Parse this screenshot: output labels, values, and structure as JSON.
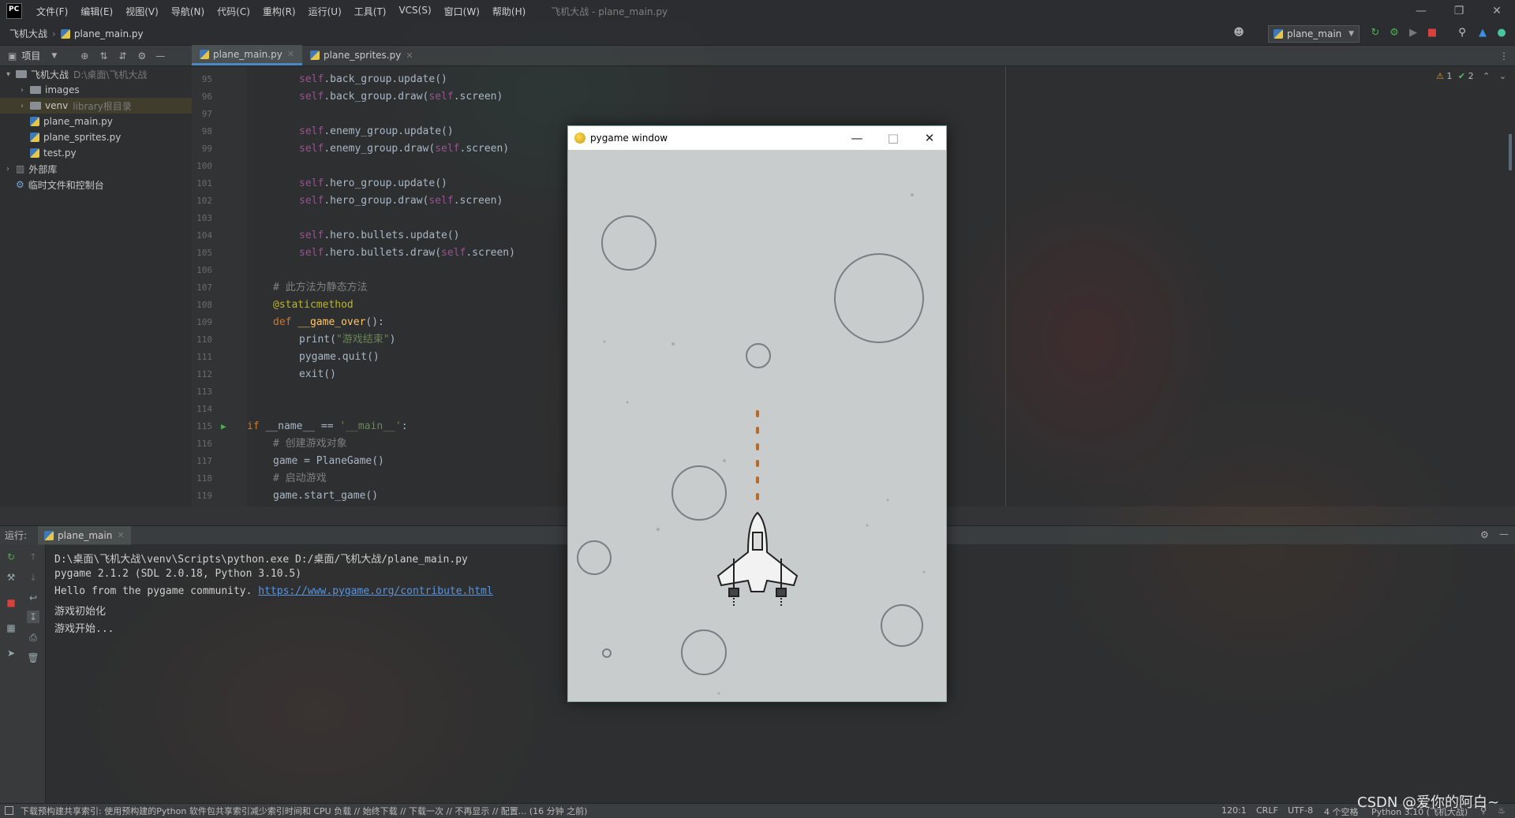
{
  "app": {
    "logo": "PC",
    "window_title": "飞机大战 - plane_main.py",
    "menu": [
      "文件(F)",
      "编辑(E)",
      "视图(V)",
      "导航(N)",
      "代码(C)",
      "重构(R)",
      "运行(U)",
      "工具(T)",
      "VCS(S)",
      "窗口(W)",
      "帮助(H)"
    ]
  },
  "navbar": {
    "project": "飞机大战",
    "file": "plane_main.py",
    "run_config": "plane_main"
  },
  "project_panel": {
    "title": "项目",
    "items": [
      {
        "label": "飞机大战",
        "hint": "D:\\桌面\\飞机大战",
        "type": "folder",
        "depth": 0,
        "expanded": true
      },
      {
        "label": "images",
        "hint": "",
        "type": "folder",
        "depth": 1,
        "expanded": false
      },
      {
        "label": "venv",
        "hint": "library根目录",
        "type": "folder",
        "depth": 1,
        "expanded": false
      },
      {
        "label": "plane_main.py",
        "hint": "",
        "type": "py",
        "depth": 1
      },
      {
        "label": "plane_sprites.py",
        "hint": "",
        "type": "py",
        "depth": 1
      },
      {
        "label": "test.py",
        "hint": "",
        "type": "py",
        "depth": 1
      },
      {
        "label": "外部库",
        "hint": "",
        "type": "lib",
        "depth": 0,
        "expanded": false
      },
      {
        "label": "临时文件和控制台",
        "hint": "",
        "type": "scratch",
        "depth": 0
      }
    ]
  },
  "editor": {
    "tabs": [
      {
        "label": "plane_main.py",
        "active": true
      },
      {
        "label": "plane_sprites.py",
        "active": false
      }
    ],
    "inspection": {
      "warnings": "1",
      "ok": "2"
    },
    "lines": [
      {
        "n": "95",
        "indent": 2,
        "tokens": [
          [
            "self",
            "self"
          ],
          [
            ".back_group.update()",
            "plain"
          ]
        ]
      },
      {
        "n": "96",
        "indent": 2,
        "tokens": [
          [
            "self",
            "self"
          ],
          [
            ".back_group.draw(",
            "plain"
          ],
          [
            "self",
            "self"
          ],
          [
            ".screen)",
            "plain"
          ]
        ]
      },
      {
        "n": "97",
        "indent": 0,
        "tokens": []
      },
      {
        "n": "98",
        "indent": 2,
        "tokens": [
          [
            "self",
            "self"
          ],
          [
            ".enemy_group.update()",
            "plain"
          ]
        ]
      },
      {
        "n": "99",
        "indent": 2,
        "tokens": [
          [
            "self",
            "self"
          ],
          [
            ".enemy_group.draw(",
            "plain"
          ],
          [
            "self",
            "self"
          ],
          [
            ".screen)",
            "plain"
          ]
        ]
      },
      {
        "n": "100",
        "indent": 0,
        "tokens": []
      },
      {
        "n": "101",
        "indent": 2,
        "tokens": [
          [
            "self",
            "self"
          ],
          [
            ".hero_group.update()",
            "plain"
          ]
        ]
      },
      {
        "n": "102",
        "indent": 2,
        "tokens": [
          [
            "self",
            "self"
          ],
          [
            ".hero_group.draw(",
            "plain"
          ],
          [
            "self",
            "self"
          ],
          [
            ".screen)",
            "plain"
          ]
        ]
      },
      {
        "n": "103",
        "indent": 0,
        "tokens": []
      },
      {
        "n": "104",
        "indent": 2,
        "tokens": [
          [
            "self",
            "self"
          ],
          [
            ".hero.bullets.update()",
            "plain"
          ]
        ]
      },
      {
        "n": "105",
        "indent": 2,
        "tokens": [
          [
            "self",
            "self"
          ],
          [
            ".hero.bullets.draw(",
            "plain"
          ],
          [
            "self",
            "self"
          ],
          [
            ".screen)",
            "plain"
          ]
        ]
      },
      {
        "n": "106",
        "indent": 0,
        "tokens": []
      },
      {
        "n": "107",
        "indent": 1,
        "tokens": [
          [
            "# 此方法为静态方法",
            "com"
          ]
        ]
      },
      {
        "n": "108",
        "indent": 1,
        "tokens": [
          [
            "@staticmethod",
            "deco"
          ]
        ]
      },
      {
        "n": "109",
        "indent": 1,
        "tokens": [
          [
            "def ",
            "kw"
          ],
          [
            "__game_over",
            "fn"
          ],
          [
            "():",
            "plain"
          ]
        ]
      },
      {
        "n": "110",
        "indent": 2,
        "tokens": [
          [
            "print(",
            "plain"
          ],
          [
            "\"游戏结束\"",
            "str"
          ],
          [
            ")",
            "plain"
          ]
        ]
      },
      {
        "n": "111",
        "indent": 2,
        "tokens": [
          [
            "pygame.quit()",
            "plain"
          ]
        ]
      },
      {
        "n": "112",
        "indent": 2,
        "tokens": [
          [
            "exit()",
            "plain"
          ]
        ]
      },
      {
        "n": "113",
        "indent": 0,
        "tokens": []
      },
      {
        "n": "114",
        "indent": 0,
        "tokens": []
      },
      {
        "n": "115",
        "indent": 0,
        "tokens": [
          [
            "if ",
            "kw"
          ],
          [
            "__name__ == ",
            "plain"
          ],
          [
            "'__main__'",
            "str"
          ],
          [
            ":",
            "plain"
          ]
        ]
      },
      {
        "n": "116",
        "indent": 1,
        "tokens": [
          [
            "# 创建游戏对象",
            "com"
          ]
        ]
      },
      {
        "n": "117",
        "indent": 1,
        "tokens": [
          [
            "game = PlaneGame()",
            "plain"
          ]
        ]
      },
      {
        "n": "118",
        "indent": 1,
        "tokens": [
          [
            "# 启动游戏",
            "com"
          ]
        ]
      },
      {
        "n": "119",
        "indent": 1,
        "tokens": [
          [
            "game.start_game()",
            "plain"
          ]
        ]
      }
    ]
  },
  "run_panel": {
    "label": "运行:",
    "tab": "plane_main",
    "output": [
      {
        "text": "D:\\桌面\\飞机大战\\venv\\Scripts\\python.exe D:/桌面/飞机大战/plane_main.py"
      },
      {
        "text": "pygame 2.1.2 (SDL 2.0.18, Python 3.10.5)"
      },
      {
        "text": "Hello from the pygame community. ",
        "link": "https://www.pygame.org/contribute.html"
      },
      {
        "text": "游戏初始化"
      },
      {
        "text": "游戏开始..."
      }
    ]
  },
  "pygame_window": {
    "title": "pygame window"
  },
  "statusbar": {
    "message": "下载预构建共享索引: 使用预构建的Python 软件包共享索引减少索引时间和 CPU 负载 // 始终下载 // 下载一次 // 不再显示 // 配置... (16 分钟 之前)",
    "position": "120:1",
    "line_sep": "CRLF",
    "encoding": "UTF-8",
    "indent": "4 个空格",
    "interpreter": "Python 3.10 (飞机大战)"
  },
  "watermark": "CSDN @爱你的阿白~"
}
